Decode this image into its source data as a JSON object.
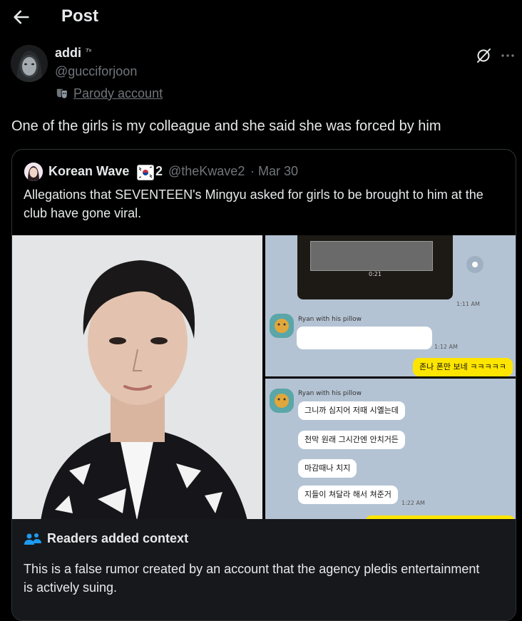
{
  "header": {
    "title": "Post",
    "back_icon": "arrow-left-icon"
  },
  "author": {
    "name": "addi",
    "name_suffix": "ᵀˢ",
    "handle": "@gucciforjoon",
    "label": "Parody account"
  },
  "post": {
    "text": "One of the girls is my colleague and she said she was forced by him"
  },
  "quoted": {
    "name": "Korean Wave",
    "name_number": "2",
    "handle": "@theKwave2",
    "separator": "·",
    "date": "Mar 30",
    "text": "Allegations that SEVENTEEN's Mingyu asked for girls to be brought to him at the club have gone viral.",
    "chat1": {
      "video_time": "0:21",
      "time1": "1:11 AM",
      "sender": "Ryan with his pillow",
      "time2": "1:12 AM",
      "my_message": "존나 폰만 보네 ㅋㅋㅋㅋㅋ"
    },
    "chat2": {
      "sender": "Ryan with his pillow",
      "messages": [
        "그니까 심지어 저때  시옐는데",
        "천막 원래 그시간엔 안치거든",
        "마감때나 치지",
        "지들이 쳐달라 해서 쳐준거"
      ],
      "time": "1:22 AM"
    }
  },
  "context": {
    "title": "Readers added context",
    "text": "This is a false rumor created by an account that the agency pledis entertainment is actively suing."
  },
  "colors": {
    "background": "#000000",
    "text": "#e7e9ea",
    "muted": "#71767b",
    "border": "#2f3336",
    "context_bg": "#16181c",
    "kakao_yellow": "#fee500",
    "chat_bg": "#b4c3d3"
  }
}
